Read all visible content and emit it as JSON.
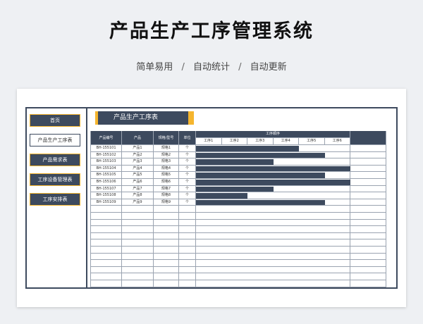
{
  "page": {
    "title": "产品生产工序管理系统",
    "subtitle_parts": [
      "简单易用",
      "自动统计",
      "自动更新"
    ],
    "separator": "/"
  },
  "sidebar": {
    "items": [
      {
        "label": "首页",
        "active": false
      },
      {
        "label": "产品生产工序表",
        "active": true
      },
      {
        "label": "产品需求表",
        "active": false
      },
      {
        "label": "工序设备管理表",
        "active": false
      },
      {
        "label": "工序安排表",
        "active": false
      }
    ]
  },
  "sheet": {
    "header_title": "产品生产工序表",
    "columns": [
      "产品编号",
      "产品",
      "规格/型号",
      "单位"
    ],
    "process_group_label": "工序顺序",
    "process_columns": [
      "工序1",
      "工序2",
      "工序3",
      "工序4",
      "工序5",
      "工序6"
    ],
    "rows": [
      {
        "code": "BH-155101",
        "product": "产品1",
        "spec": "规格1",
        "unit": "个",
        "steps": 4
      },
      {
        "code": "BH-155102",
        "product": "产品2",
        "spec": "规格2",
        "unit": "个",
        "steps": 5
      },
      {
        "code": "BH-155103",
        "product": "产品3",
        "spec": "规格3",
        "unit": "个",
        "steps": 3
      },
      {
        "code": "BH-155104",
        "product": "产品4",
        "spec": "规格4",
        "unit": "个",
        "steps": 6
      },
      {
        "code": "BH-155105",
        "product": "产品5",
        "spec": "规格5",
        "unit": "个",
        "steps": 5
      },
      {
        "code": "BH-155106",
        "product": "产品6",
        "spec": "规格6",
        "unit": "个",
        "steps": 6
      },
      {
        "code": "BH-155107",
        "product": "产品7",
        "spec": "规格7",
        "unit": "个",
        "steps": 3
      },
      {
        "code": "BH-155108",
        "product": "产品8",
        "spec": "规格8",
        "unit": "个",
        "steps": 2
      },
      {
        "code": "BH-155109",
        "product": "产品9",
        "spec": "规格9",
        "unit": "个",
        "steps": 5
      }
    ],
    "blank_row_count": 12
  },
  "colors": {
    "navy": "#3d4a5e",
    "accent": "#f5b52e"
  }
}
